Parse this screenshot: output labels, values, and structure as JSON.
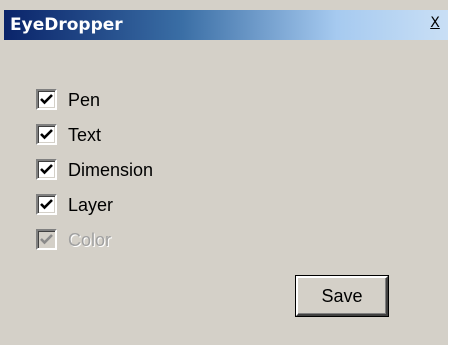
{
  "window": {
    "title": "EyeDropper",
    "close_label": "X"
  },
  "options": [
    {
      "label": "Pen",
      "checked": true,
      "enabled": true
    },
    {
      "label": "Text",
      "checked": true,
      "enabled": true
    },
    {
      "label": "Dimension",
      "checked": true,
      "enabled": true
    },
    {
      "label": "Layer",
      "checked": true,
      "enabled": true
    },
    {
      "label": "Color",
      "checked": true,
      "enabled": false
    }
  ],
  "buttons": {
    "save_label": "Save"
  },
  "colors": {
    "dialog_background": "#d4d0c8",
    "titlebar_start": "#0a246a",
    "titlebar_end": "#c9dff5",
    "disabled_text": "#a0a0a0"
  }
}
